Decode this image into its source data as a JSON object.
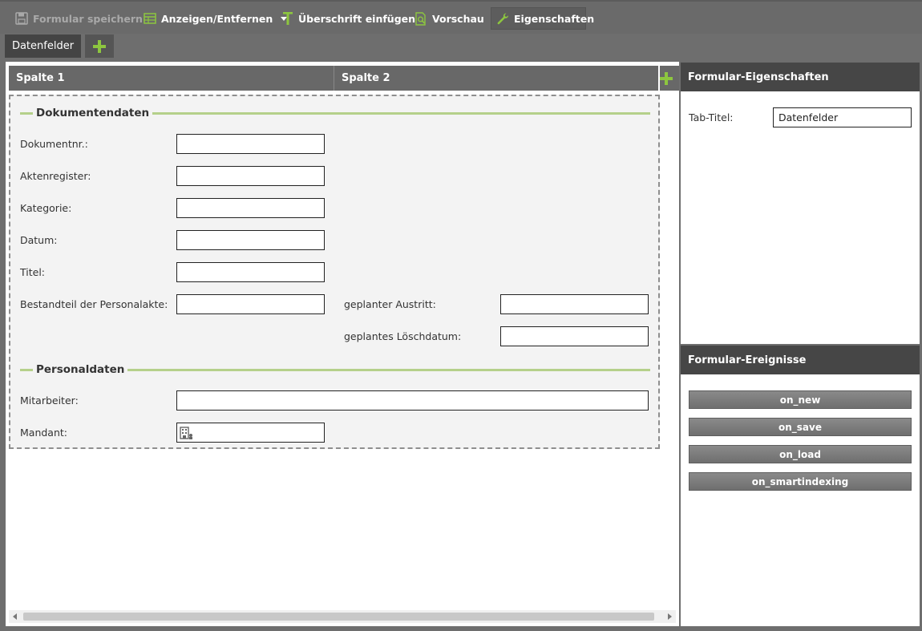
{
  "toolbar": {
    "save_label": "Formular speichern",
    "toggle_label": "Anzeigen/Entfernen",
    "heading_label": "Überschrift einfügen",
    "preview_label": "Vorschau",
    "properties_label": "Eigenschaften"
  },
  "tabs": [
    {
      "label": "Datenfelder"
    }
  ],
  "columns": {
    "col1": "Spalte 1",
    "col2": "Spalte 2"
  },
  "form": {
    "section1": {
      "title": "Dokumentendaten",
      "fields": {
        "dokumentnr": "Dokumentnr.:",
        "aktenregister": "Aktenregister:",
        "kategorie": "Kategorie:",
        "datum": "Datum:",
        "titel": "Titel:",
        "bestandteil": "Bestandteil der Personalakte:",
        "austritt": "geplanter Austritt:",
        "loeschdatum": "geplantes Löschdatum:"
      }
    },
    "section2": {
      "title": "Personaldaten",
      "fields": {
        "mitarbeiter": "Mitarbeiter:",
        "mandant": "Mandant:"
      }
    }
  },
  "properties_panel": {
    "title": "Formular-Eigenschaften",
    "tab_title_label": "Tab-Titel:",
    "tab_title_value": "Datenfelder"
  },
  "events_panel": {
    "title": "Formular-Ereignisse",
    "events": [
      "on_new",
      "on_save",
      "on_load",
      "on_smartindexing"
    ]
  },
  "colors": {
    "accent": "#8dc63f",
    "toolbar_bg": "#6a6a6a",
    "panel_header": "#464646",
    "section_line": "#b5d08a"
  }
}
